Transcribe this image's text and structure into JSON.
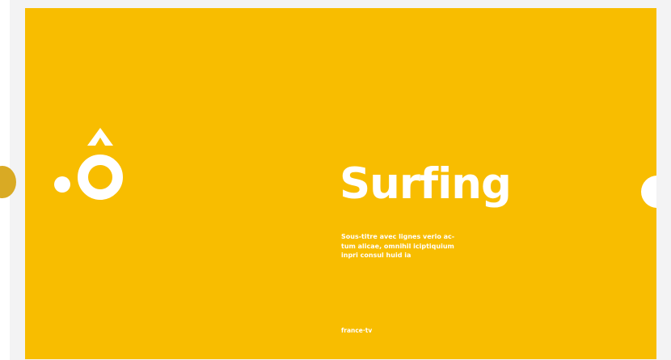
{
  "slide": {
    "background_color": "#f8bd00",
    "title": "Surfing",
    "subtitle_lines": [
      "Sous-titre avec lignes verio ac-",
      "tum alicae, omnihil iciptiquium",
      "inpri consul huid ia"
    ],
    "brand": "france·tv",
    "logo_icon": "o-circumflex-logo-icon"
  },
  "carousel": {
    "previous_slide_color": "#d9aa24",
    "next_icon": "next-slide-dot-icon"
  }
}
